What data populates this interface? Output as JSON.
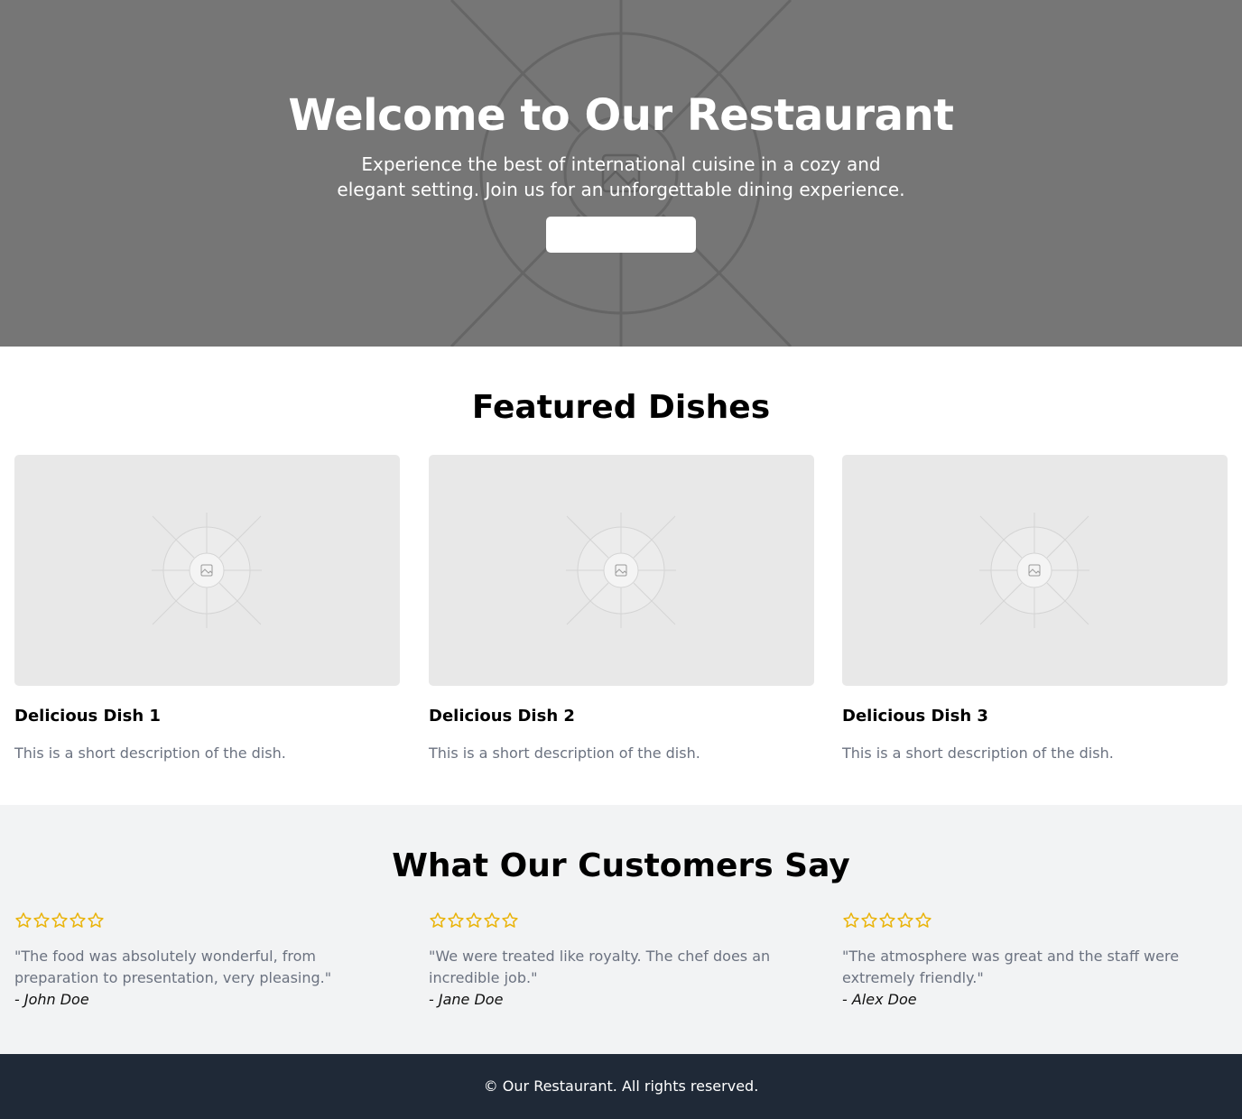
{
  "hero": {
    "title": "Welcome to Our Restaurant",
    "subtitle": "Experience the best of international cuisine in a cozy and elegant setting. Join us for an unforgettable dining experience.",
    "button_label": ""
  },
  "featured": {
    "title": "Featured Dishes",
    "dishes": [
      {
        "name": "Delicious Dish 1",
        "description": "This is a short description of the dish.",
        "image_icon": "image-placeholder-icon"
      },
      {
        "name": "Delicious Dish 2",
        "description": "This is a short description of the dish.",
        "image_icon": "image-placeholder-icon"
      },
      {
        "name": "Delicious Dish 3",
        "description": "This is a short description of the dish.",
        "image_icon": "image-placeholder-icon"
      }
    ]
  },
  "testimonials": {
    "title": "What Our Customers Say",
    "star_icon": "star-outline-icon",
    "star_color": "#eab308",
    "reviews": [
      {
        "rating": 5,
        "text": "\"The food was absolutely wonderful, from preparation to presentation, very pleasing.\"",
        "author": "- John Doe"
      },
      {
        "rating": 5,
        "text": "\"We were treated like royalty. The chef does an incredible job.\"",
        "author": "- Jane Doe"
      },
      {
        "rating": 5,
        "text": "\"The atmosphere was great and the staff were extremely friendly.\"",
        "author": "- Alex Doe"
      }
    ]
  },
  "footer": {
    "text": "© Our Restaurant. All rights reserved."
  },
  "colors": {
    "hero_bg": "#767676",
    "testimonials_bg": "#f2f3f4",
    "footer_bg": "#1f2937",
    "muted_text": "#6b7280"
  }
}
